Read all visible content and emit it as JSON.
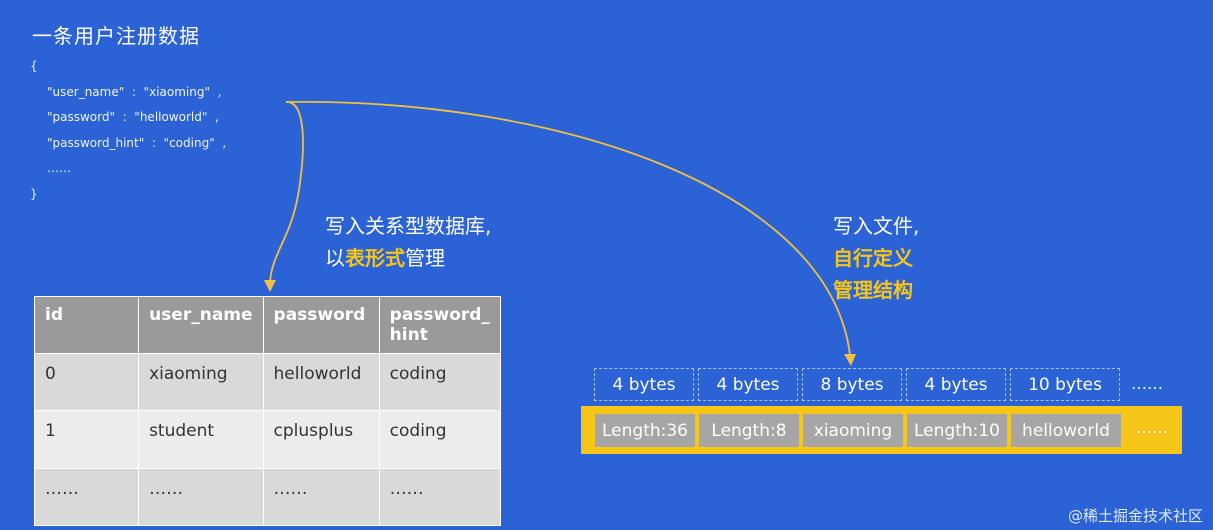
{
  "title": "一条用户注册数据",
  "json_lines": {
    "open": "{",
    "l1": "\"user_name\"  :  \"xiaoming\"  ,",
    "l2": "\"password\"  :  \"helloworld\"  ,",
    "l3": "\"password_hint\"  :  \"coding\"  ,",
    "l4": "……",
    "close": "}"
  },
  "annotation_db": {
    "line1": "写入关系型数据库,",
    "line2_pre": "以",
    "line2_hl": "表形式",
    "line2_post": "管理"
  },
  "annotation_file": {
    "line1": "写入文件,",
    "line2": "自行定义",
    "line3": "管理结构"
  },
  "table": {
    "headers": [
      "id",
      "user_name",
      "password",
      "password_\nhint"
    ],
    "rows": [
      [
        "0",
        "xiaoming",
        "helloworld",
        "coding"
      ],
      [
        "1",
        "student",
        "cplusplus",
        "coding"
      ],
      [
        "……",
        "……",
        "……",
        "……"
      ]
    ]
  },
  "byte_sizes": [
    "4 bytes",
    "4 bytes",
    "8 bytes",
    "4 bytes",
    "10 bytes"
  ],
  "byte_sizes_more": "……",
  "file_fields": [
    "Length:36",
    "Length:8",
    "xiaoming",
    "Length:10",
    "helloworld"
  ],
  "file_fields_more": "……",
  "watermark": "@稀土掘金技术社区",
  "colors": {
    "background": "#2b62d6",
    "accent": "#f5c518",
    "table_header": "#9a9a9a",
    "cell_gray": "#a6a6a6",
    "arrow": "#f0c040"
  }
}
